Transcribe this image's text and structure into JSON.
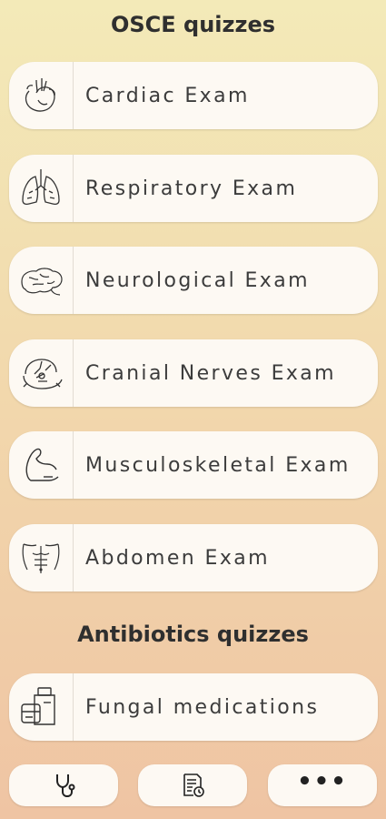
{
  "sections": {
    "osce_title": "OSCE quizzes",
    "antibiotics_title": "Antibiotics quizzes"
  },
  "osce_items": [
    {
      "label": "Cardiac Exam",
      "icon": "heart-icon"
    },
    {
      "label": "Respiratory Exam",
      "icon": "lungs-icon"
    },
    {
      "label": "Neurological Exam",
      "icon": "brain-icon"
    },
    {
      "label": "Cranial Nerves Exam",
      "icon": "cranial-nerves-icon"
    },
    {
      "label": "Musculoskeletal Exam",
      "icon": "arm-muscle-icon"
    },
    {
      "label": "Abdomen Exam",
      "icon": "torso-icon"
    }
  ],
  "antibiotics_items": [
    {
      "label": "Fungal medications",
      "icon": "medication-bottle-icon"
    }
  ],
  "bottom_nav": {
    "items": [
      {
        "icon": "stethoscope-icon"
      },
      {
        "icon": "document-clock-icon"
      },
      {
        "icon": "more-icon",
        "text": "•••"
      }
    ]
  },
  "colors": {
    "background_top": "#f3eab8",
    "background_bottom": "#efc4a3",
    "card": "#fdf9f3"
  }
}
